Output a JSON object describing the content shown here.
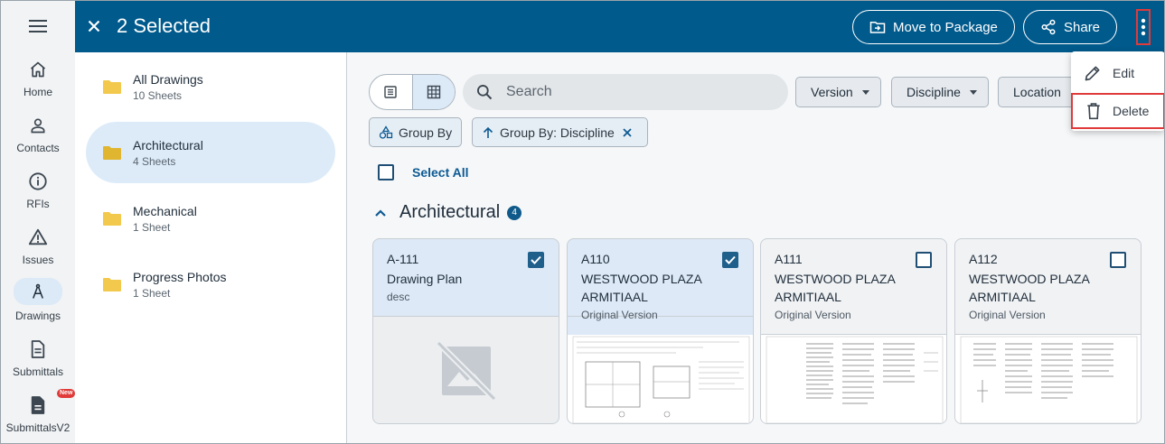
{
  "rail": {
    "items": [
      {
        "label": "Home",
        "icon": "home-icon"
      },
      {
        "label": "Contacts",
        "icon": "person-icon"
      },
      {
        "label": "RFIs",
        "icon": "info-icon"
      },
      {
        "label": "Issues",
        "icon": "warning-icon"
      },
      {
        "label": "Drawings",
        "icon": "compass-icon"
      },
      {
        "label": "Submittals",
        "icon": "document-icon"
      },
      {
        "label": "SubmittalsV2",
        "icon": "document-icon",
        "badge": "New"
      }
    ]
  },
  "header": {
    "title": "2 Selected",
    "move_label": "Move to Package",
    "share_label": "Share",
    "bg": "#005a8c"
  },
  "folders": [
    {
      "name": "All Drawings",
      "count": "10 Sheets"
    },
    {
      "name": "Architectural",
      "count": "4 Sheets"
    },
    {
      "name": "Mechanical",
      "count": "1 Sheet"
    },
    {
      "name": "Progress Photos",
      "count": "1 Sheet"
    }
  ],
  "toolbar": {
    "search_placeholder": "Search",
    "filters": [
      "Version",
      "Discipline",
      "Location"
    ],
    "group_by_label": "Group By",
    "group_chip_label": "Group By: Discipline"
  },
  "select_all_label": "Select All",
  "group": {
    "title": "Architectural",
    "count": "4"
  },
  "cards": [
    {
      "number": "A-111",
      "name": "Drawing Plan",
      "version": "desc",
      "selected": true
    },
    {
      "number": "A110",
      "name": "WESTWOOD PLAZA ARMITIAAL",
      "version": "Original Version",
      "selected": true
    },
    {
      "number": "A111",
      "name": "WESTWOOD PLAZA ARMITIAAL",
      "version": "Original Version",
      "selected": false
    },
    {
      "number": "A112",
      "name": "WESTWOOD PLAZA ARMITIAAL",
      "version": "Original Version",
      "selected": false
    }
  ],
  "menu": {
    "edit_label": "Edit",
    "delete_label": "Delete"
  }
}
